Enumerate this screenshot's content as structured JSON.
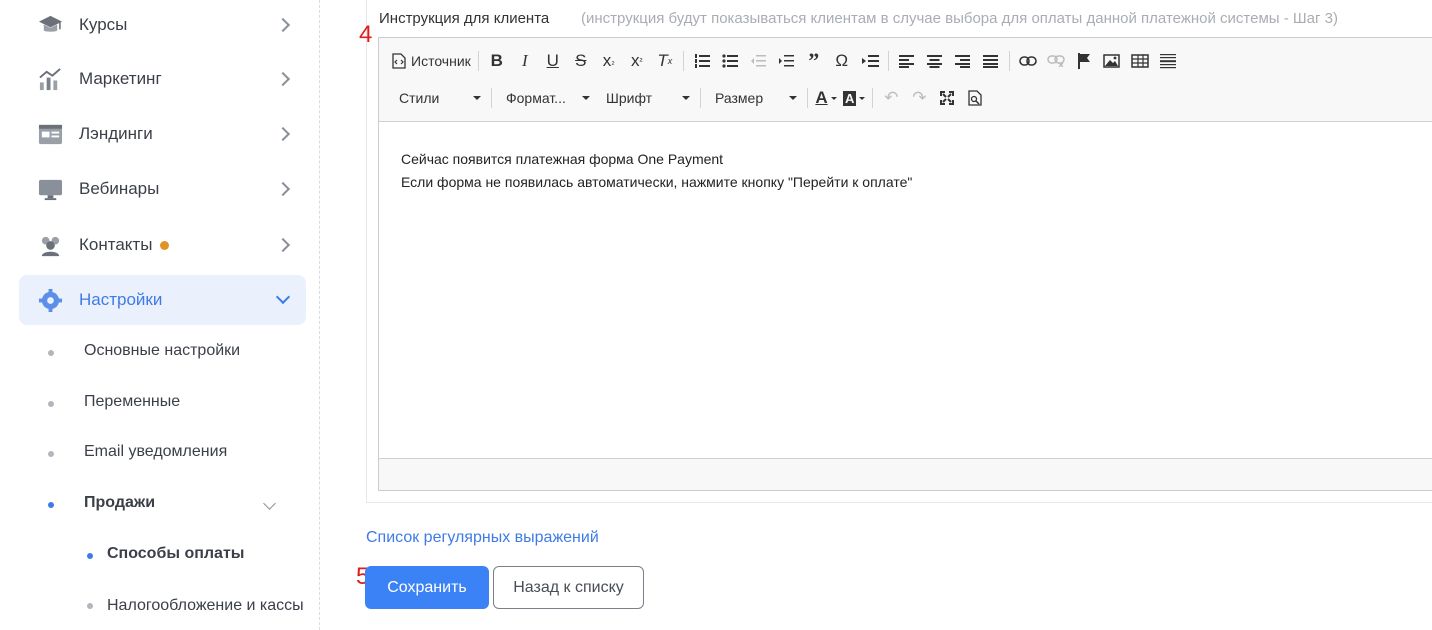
{
  "sidebar": {
    "items": [
      {
        "label": "Курсы",
        "icon": "graduation-cap-icon"
      },
      {
        "label": "Маркетинг",
        "icon": "bar-chart-icon"
      },
      {
        "label": "Лэндинги",
        "icon": "landing-page-icon"
      },
      {
        "label": "Вебинары",
        "icon": "monitor-icon"
      },
      {
        "label": "Контакты",
        "icon": "users-icon",
        "badge_color": "#e29223"
      },
      {
        "label": "Настройки",
        "icon": "gear-icon",
        "active": true
      }
    ],
    "sub_items": [
      {
        "label": "Основные настройки"
      },
      {
        "label": "Переменные"
      },
      {
        "label": "Email уведомления"
      },
      {
        "label": "Продажи"
      }
    ],
    "sub_sub_items": [
      {
        "label": "Способы оплаты"
      },
      {
        "label": "Налогообложение и кассы"
      }
    ]
  },
  "field": {
    "title": "Инструкция для клиента",
    "hint": "(инструкция будут показываться клиентам в случае выбора для оплаты данной платежной системы - Шаг 3)"
  },
  "annotations": {
    "step4": "4",
    "step5": "5"
  },
  "editor": {
    "source_label": "Источник",
    "styles_label": "Стили",
    "format_label": "Формат...",
    "font_label": "Шрифт",
    "size_label": "Размер",
    "content": [
      "Сейчас появится платежная форма One Payment",
      "Если форма не появилась автоматически, нажмите кнопку \"Перейти к оплате\""
    ]
  },
  "links": {
    "regex_list": "Список регулярных выражений"
  },
  "buttons": {
    "save": "Сохранить",
    "back": "Назад к списку"
  },
  "colors": {
    "accent": "#3e7be8",
    "primary_button": "#3b82f6",
    "annotation": "#e01c1c"
  }
}
